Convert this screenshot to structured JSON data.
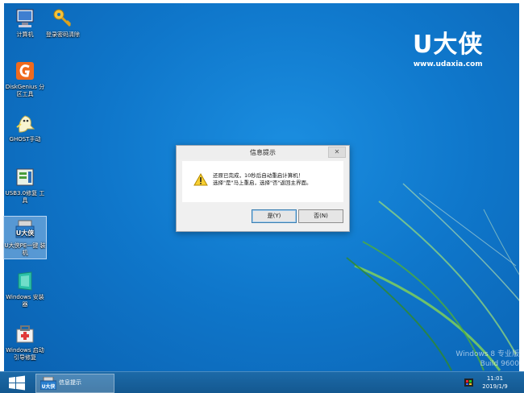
{
  "desktop": {
    "icons": [
      {
        "label": "计算机",
        "icon": "computer-icon"
      },
      {
        "label": "登录密码清除",
        "icon": "key-icon"
      },
      {
        "label": "DiskGenius 分区工具",
        "icon": "diskgenius-icon"
      },
      {
        "label": "GHOST手动",
        "icon": "ghost-icon"
      },
      {
        "label": "USB3.0修复 工具",
        "icon": "usb-repair-icon"
      },
      {
        "label": "U大侠PE一键 装机",
        "icon": "udaxia-installer-icon"
      },
      {
        "label": "Windows 安装器",
        "icon": "windows-installer-icon"
      },
      {
        "label": "Windows 启动引导修复",
        "icon": "boot-repair-icon"
      }
    ],
    "brand": {
      "name": "U大侠",
      "url": "www.udaxia.com"
    },
    "watermark": {
      "line1": "Windows 8 专业版",
      "line2": "Build 9600"
    }
  },
  "dialog": {
    "title": "信息提示",
    "close": "✕",
    "message_line1": "还原已完成，10秒后自动重启计算机！",
    "message_line2": "选择\"是\"马上重启，选择\"否\"返回主界面。",
    "yes_label": "是(Y)",
    "no_label": "否(N)"
  },
  "taskbar": {
    "task_label": "信息提示",
    "time": "11:01",
    "date": "2019/1/9"
  },
  "colors": {
    "desktop": "#0f77cb",
    "taskbar": "#13578f",
    "accent": "#3c7fb1"
  }
}
